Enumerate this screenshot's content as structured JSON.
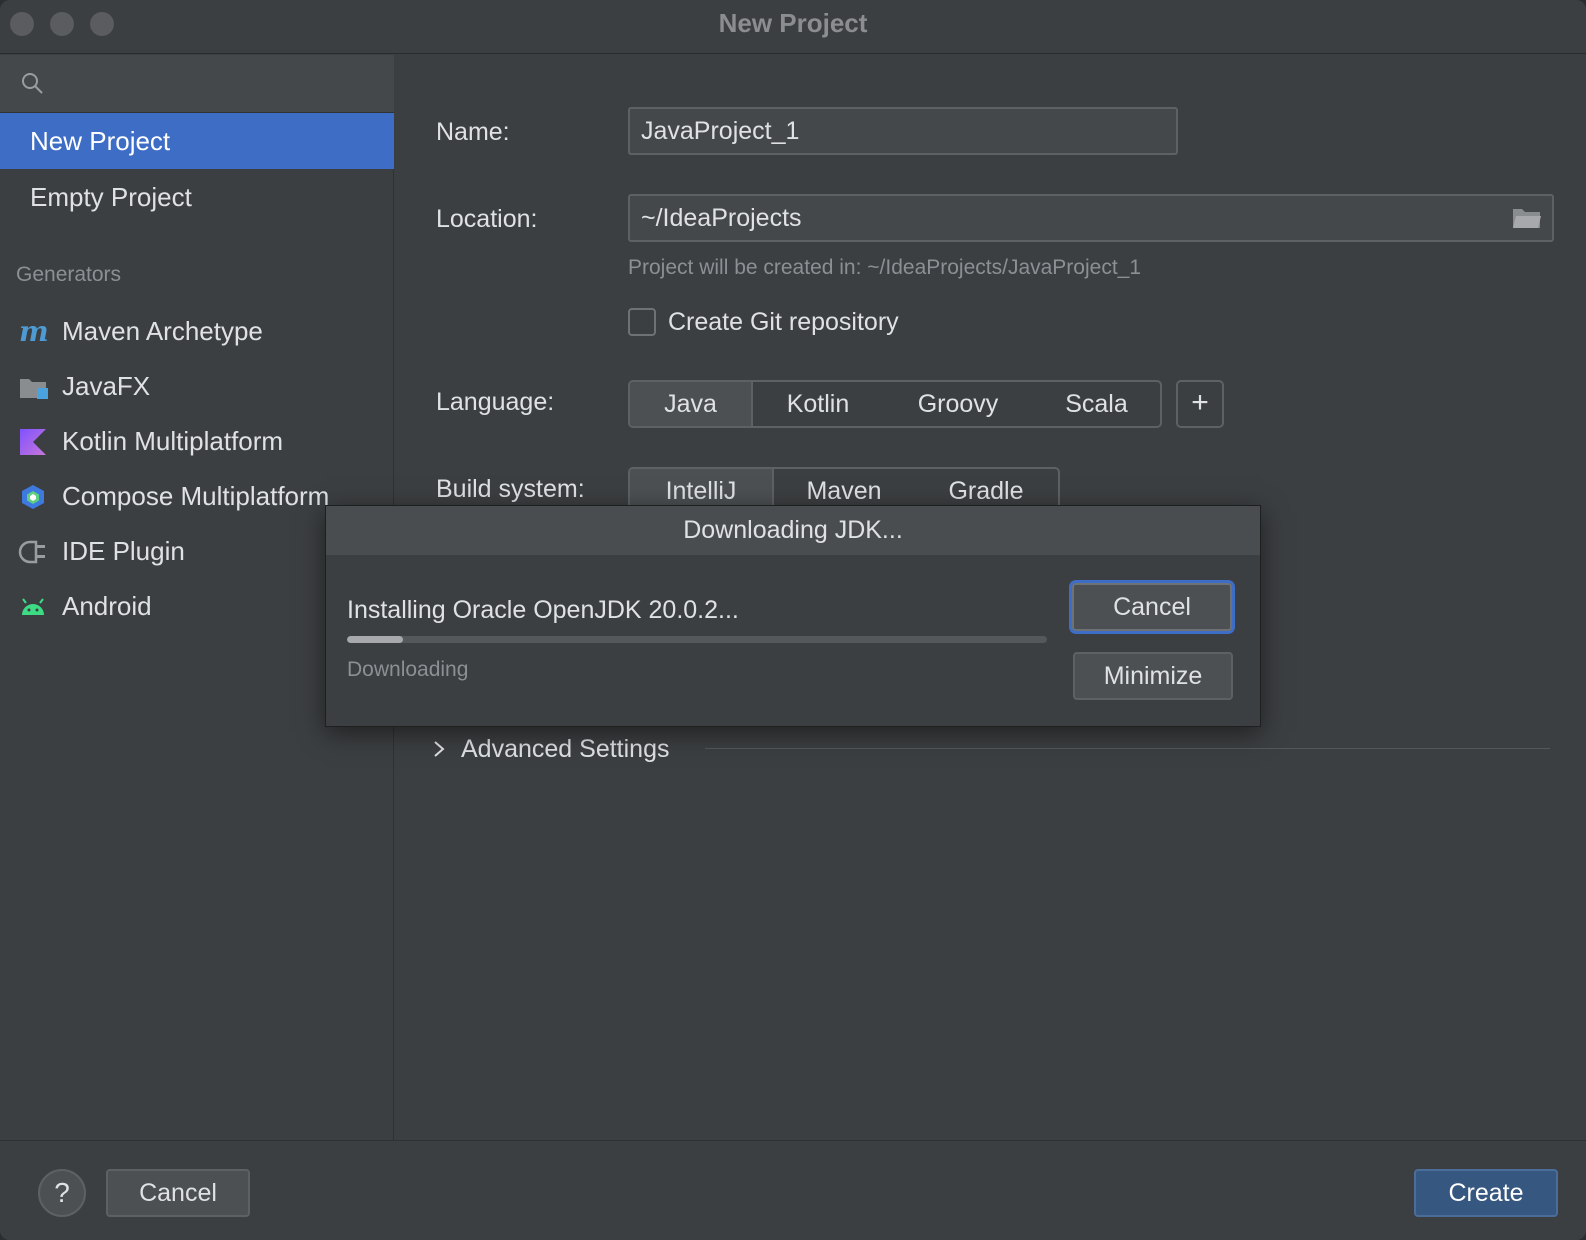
{
  "window": {
    "title": "New Project"
  },
  "sidebar": {
    "search": {
      "value": "",
      "placeholder": ""
    },
    "items": [
      {
        "label": "New Project",
        "selected": true
      },
      {
        "label": "Empty Project",
        "selected": false
      }
    ],
    "generators_header": "Generators",
    "generators": [
      {
        "label": "Maven Archetype",
        "icon": "maven-icon"
      },
      {
        "label": "JavaFX",
        "icon": "javafx-icon"
      },
      {
        "label": "Kotlin Multiplatform",
        "icon": "kotlin-icon"
      },
      {
        "label": "Compose Multiplatform",
        "icon": "compose-icon"
      },
      {
        "label": "IDE Plugin",
        "icon": "plugin-icon"
      },
      {
        "label": "Android",
        "icon": "android-icon"
      }
    ]
  },
  "form": {
    "name_label": "Name:",
    "name_value": "JavaProject_1",
    "location_label": "Location:",
    "location_value": "~/IdeaProjects",
    "location_hint": "Project will be created in: ~/IdeaProjects/JavaProject_1",
    "git_label": "Create Git repository",
    "git_checked": false,
    "language_label": "Language:",
    "languages": [
      "Java",
      "Kotlin",
      "Groovy",
      "Scala"
    ],
    "language_selected": "Java",
    "add_language": "+",
    "build_label": "Build system:",
    "build_systems": [
      "IntelliJ",
      "Maven",
      "Gradle"
    ],
    "build_selected": "IntelliJ",
    "advanced_label": "Advanced Settings"
  },
  "dialog": {
    "title": "Downloading JDK...",
    "status": "Installing Oracle OpenJDK 20.0.2...",
    "substatus": "Downloading",
    "progress": 0.08,
    "cancel_label": "Cancel",
    "minimize_label": "Minimize"
  },
  "footer": {
    "help_label": "?",
    "cancel_label": "Cancel",
    "create_label": "Create"
  },
  "colors": {
    "accent": "#3d6dc4",
    "primary_button": "#365880",
    "background": "#3c3f41"
  }
}
